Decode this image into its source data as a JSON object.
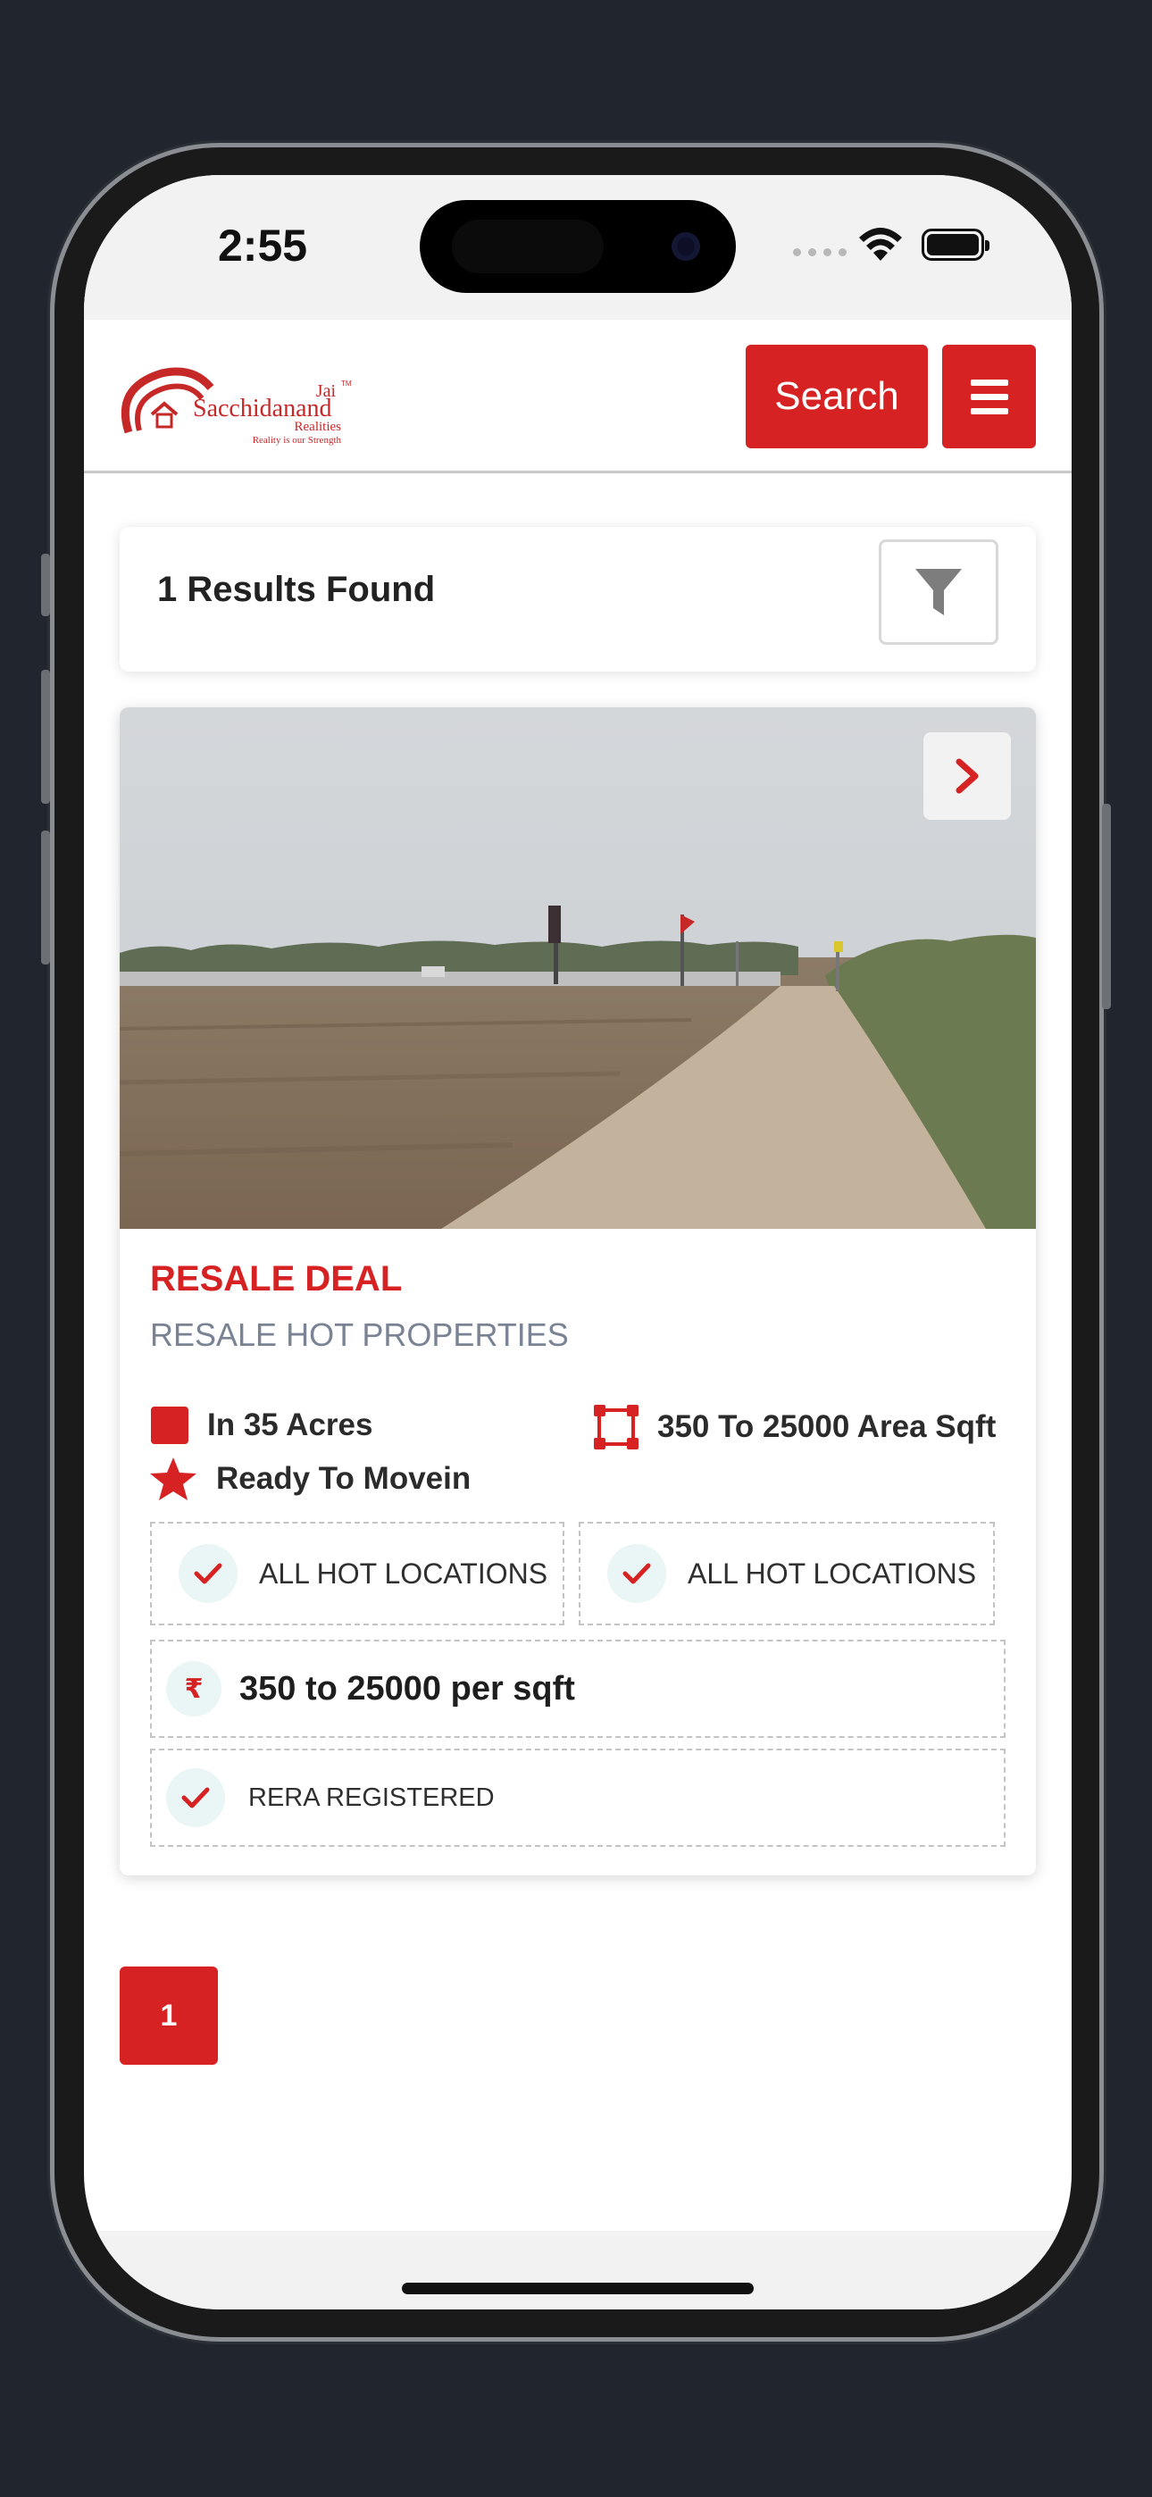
{
  "status_bar": {
    "time": "2:55"
  },
  "header": {
    "logo": {
      "name_top": "Jai",
      "name_main": "Sacchidanand",
      "name_sub": "Realities",
      "tagline": "Reality is our Strength",
      "trademark": "TM"
    },
    "search_label": "Search",
    "menu_icon": "hamburger-icon"
  },
  "results": {
    "text": "1 Results Found",
    "filter_icon": "filter-icon"
  },
  "listing": {
    "photo_icon": "chevron-right-icon",
    "title": "RESALE DEAL",
    "subtitle": "RESALE HOT PROPERTIES",
    "area_acres": "In 35 Acres",
    "area_sqft": "350 To 25000 Area Sqft",
    "status": "Ready To Movein",
    "locations": [
      "ALL HOT LOCATIONS",
      "ALL HOT LOCATIONS"
    ],
    "price": "350 to 25000 per sqft",
    "currency_symbol": "₹",
    "rera": "RERA REGISTERED"
  },
  "pagination": {
    "current": "1"
  },
  "colors": {
    "accent": "#d62223",
    "muted": "#7a8393",
    "tick_bg": "#eaf6f6"
  }
}
